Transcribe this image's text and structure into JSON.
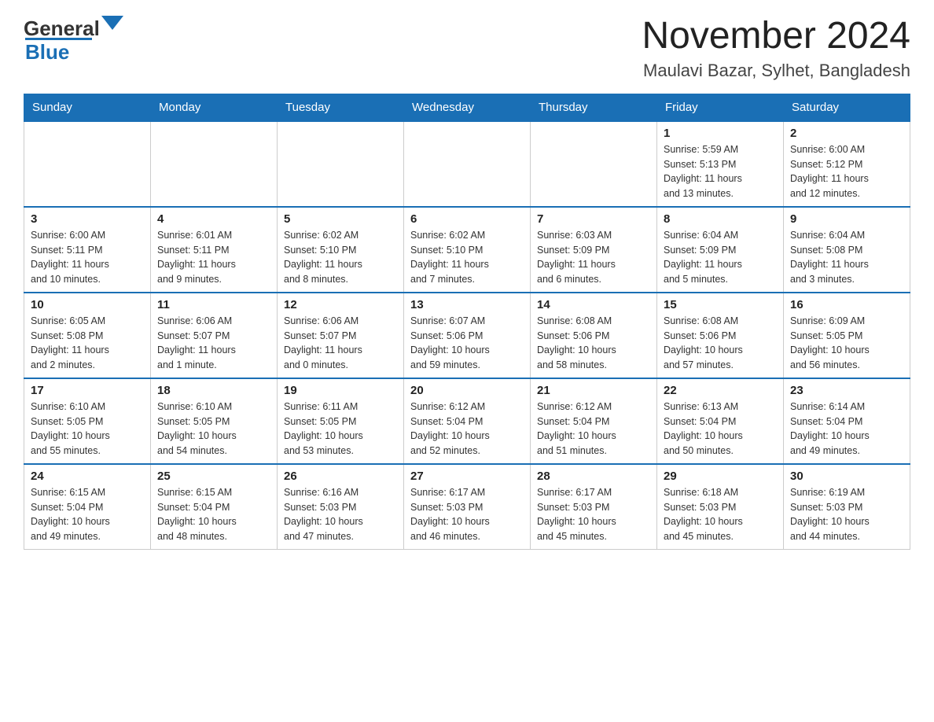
{
  "header": {
    "logo": {
      "text_general": "General",
      "text_blue": "Blue"
    },
    "title": "November 2024",
    "location": "Maulavi Bazar, Sylhet, Bangladesh"
  },
  "calendar": {
    "days_of_week": [
      "Sunday",
      "Monday",
      "Tuesday",
      "Wednesday",
      "Thursday",
      "Friday",
      "Saturday"
    ],
    "weeks": [
      [
        {
          "day": "",
          "info": ""
        },
        {
          "day": "",
          "info": ""
        },
        {
          "day": "",
          "info": ""
        },
        {
          "day": "",
          "info": ""
        },
        {
          "day": "",
          "info": ""
        },
        {
          "day": "1",
          "info": "Sunrise: 5:59 AM\nSunset: 5:13 PM\nDaylight: 11 hours\nand 13 minutes."
        },
        {
          "day": "2",
          "info": "Sunrise: 6:00 AM\nSunset: 5:12 PM\nDaylight: 11 hours\nand 12 minutes."
        }
      ],
      [
        {
          "day": "3",
          "info": "Sunrise: 6:00 AM\nSunset: 5:11 PM\nDaylight: 11 hours\nand 10 minutes."
        },
        {
          "day": "4",
          "info": "Sunrise: 6:01 AM\nSunset: 5:11 PM\nDaylight: 11 hours\nand 9 minutes."
        },
        {
          "day": "5",
          "info": "Sunrise: 6:02 AM\nSunset: 5:10 PM\nDaylight: 11 hours\nand 8 minutes."
        },
        {
          "day": "6",
          "info": "Sunrise: 6:02 AM\nSunset: 5:10 PM\nDaylight: 11 hours\nand 7 minutes."
        },
        {
          "day": "7",
          "info": "Sunrise: 6:03 AM\nSunset: 5:09 PM\nDaylight: 11 hours\nand 6 minutes."
        },
        {
          "day": "8",
          "info": "Sunrise: 6:04 AM\nSunset: 5:09 PM\nDaylight: 11 hours\nand 5 minutes."
        },
        {
          "day": "9",
          "info": "Sunrise: 6:04 AM\nSunset: 5:08 PM\nDaylight: 11 hours\nand 3 minutes."
        }
      ],
      [
        {
          "day": "10",
          "info": "Sunrise: 6:05 AM\nSunset: 5:08 PM\nDaylight: 11 hours\nand 2 minutes."
        },
        {
          "day": "11",
          "info": "Sunrise: 6:06 AM\nSunset: 5:07 PM\nDaylight: 11 hours\nand 1 minute."
        },
        {
          "day": "12",
          "info": "Sunrise: 6:06 AM\nSunset: 5:07 PM\nDaylight: 11 hours\nand 0 minutes."
        },
        {
          "day": "13",
          "info": "Sunrise: 6:07 AM\nSunset: 5:06 PM\nDaylight: 10 hours\nand 59 minutes."
        },
        {
          "day": "14",
          "info": "Sunrise: 6:08 AM\nSunset: 5:06 PM\nDaylight: 10 hours\nand 58 minutes."
        },
        {
          "day": "15",
          "info": "Sunrise: 6:08 AM\nSunset: 5:06 PM\nDaylight: 10 hours\nand 57 minutes."
        },
        {
          "day": "16",
          "info": "Sunrise: 6:09 AM\nSunset: 5:05 PM\nDaylight: 10 hours\nand 56 minutes."
        }
      ],
      [
        {
          "day": "17",
          "info": "Sunrise: 6:10 AM\nSunset: 5:05 PM\nDaylight: 10 hours\nand 55 minutes."
        },
        {
          "day": "18",
          "info": "Sunrise: 6:10 AM\nSunset: 5:05 PM\nDaylight: 10 hours\nand 54 minutes."
        },
        {
          "day": "19",
          "info": "Sunrise: 6:11 AM\nSunset: 5:05 PM\nDaylight: 10 hours\nand 53 minutes."
        },
        {
          "day": "20",
          "info": "Sunrise: 6:12 AM\nSunset: 5:04 PM\nDaylight: 10 hours\nand 52 minutes."
        },
        {
          "day": "21",
          "info": "Sunrise: 6:12 AM\nSunset: 5:04 PM\nDaylight: 10 hours\nand 51 minutes."
        },
        {
          "day": "22",
          "info": "Sunrise: 6:13 AM\nSunset: 5:04 PM\nDaylight: 10 hours\nand 50 minutes."
        },
        {
          "day": "23",
          "info": "Sunrise: 6:14 AM\nSunset: 5:04 PM\nDaylight: 10 hours\nand 49 minutes."
        }
      ],
      [
        {
          "day": "24",
          "info": "Sunrise: 6:15 AM\nSunset: 5:04 PM\nDaylight: 10 hours\nand 49 minutes."
        },
        {
          "day": "25",
          "info": "Sunrise: 6:15 AM\nSunset: 5:04 PM\nDaylight: 10 hours\nand 48 minutes."
        },
        {
          "day": "26",
          "info": "Sunrise: 6:16 AM\nSunset: 5:03 PM\nDaylight: 10 hours\nand 47 minutes."
        },
        {
          "day": "27",
          "info": "Sunrise: 6:17 AM\nSunset: 5:03 PM\nDaylight: 10 hours\nand 46 minutes."
        },
        {
          "day": "28",
          "info": "Sunrise: 6:17 AM\nSunset: 5:03 PM\nDaylight: 10 hours\nand 45 minutes."
        },
        {
          "day": "29",
          "info": "Sunrise: 6:18 AM\nSunset: 5:03 PM\nDaylight: 10 hours\nand 45 minutes."
        },
        {
          "day": "30",
          "info": "Sunrise: 6:19 AM\nSunset: 5:03 PM\nDaylight: 10 hours\nand 44 minutes."
        }
      ]
    ]
  }
}
